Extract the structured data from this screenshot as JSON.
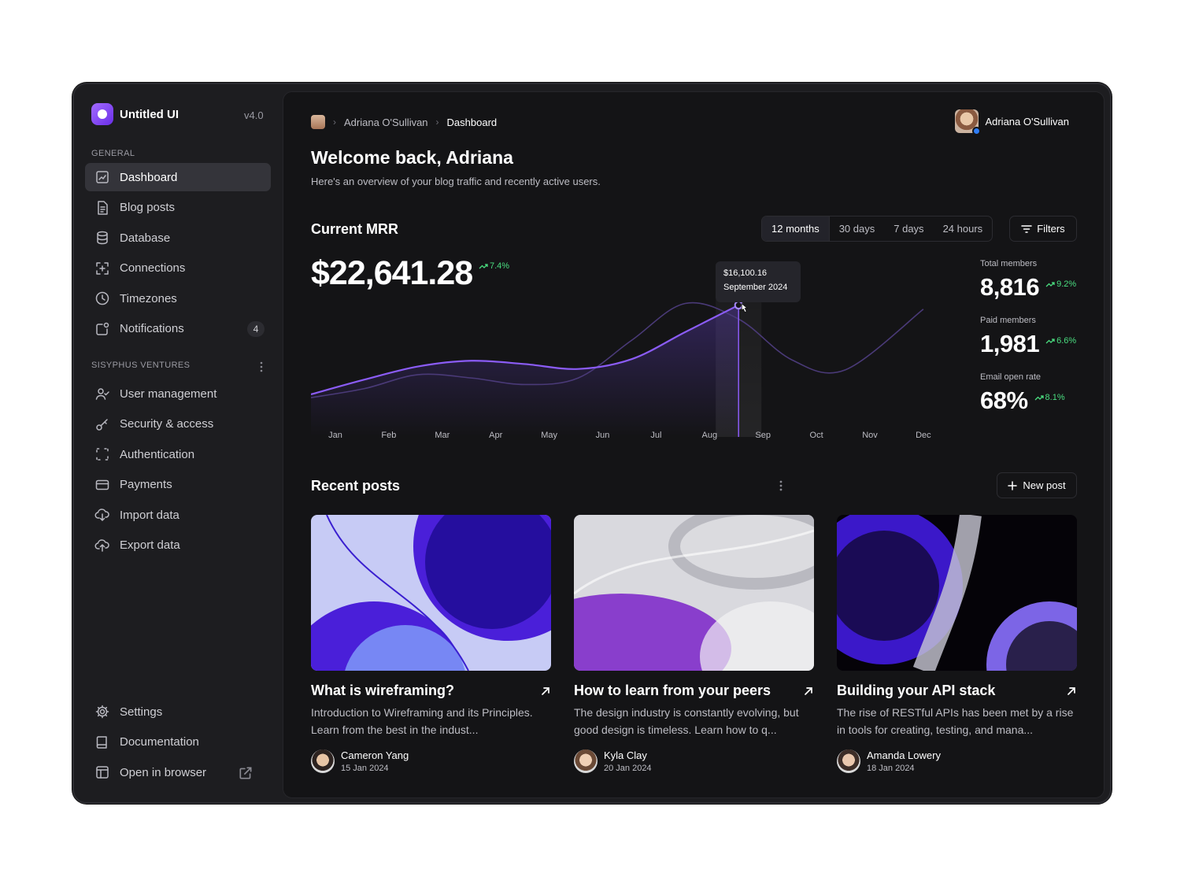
{
  "brand": {
    "name": "Untitled UI",
    "version": "v4.0"
  },
  "sidebar": {
    "general_label": "GENERAL",
    "general_items": [
      {
        "label": "Dashboard",
        "icon": "chart-icon",
        "active": true
      },
      {
        "label": "Blog posts",
        "icon": "document-icon"
      },
      {
        "label": "Database",
        "icon": "database-icon"
      },
      {
        "label": "Connections",
        "icon": "connections-icon"
      },
      {
        "label": "Timezones",
        "icon": "clock-icon"
      },
      {
        "label": "Notifications",
        "icon": "notification-icon",
        "badge": "4"
      }
    ],
    "workspace_label": "SISYPHUS VENTURES",
    "workspace_items": [
      {
        "label": "User management",
        "icon": "users-icon"
      },
      {
        "label": "Security & access",
        "icon": "key-icon"
      },
      {
        "label": "Authentication",
        "icon": "scan-icon"
      },
      {
        "label": "Payments",
        "icon": "credit-card-icon"
      },
      {
        "label": "Import data",
        "icon": "cloud-download-icon"
      },
      {
        "label": "Export data",
        "icon": "cloud-upload-icon"
      }
    ],
    "footer_items": [
      {
        "label": "Settings",
        "icon": "gear-icon"
      },
      {
        "label": "Documentation",
        "icon": "book-icon"
      },
      {
        "label": "Open in browser",
        "icon": "browser-icon"
      }
    ]
  },
  "breadcrumb": {
    "parent": "Adriana O'Sullivan",
    "current": "Dashboard"
  },
  "user": {
    "name": "Adriana O'Sullivan"
  },
  "header": {
    "title": "Welcome back, Adriana",
    "subtitle": "Here's an overview of your blog traffic and recently active users."
  },
  "mrr": {
    "title": "Current MRR",
    "value": "$22,641.28",
    "delta": "7.4%",
    "ranges": [
      "12 months",
      "30 days",
      "7 days",
      "24 hours"
    ],
    "active_range": "12 months",
    "filters_label": "Filters",
    "tooltip": {
      "value": "$16,100.16",
      "label": "September 2024"
    }
  },
  "chart_data": {
    "type": "line",
    "categories": [
      "Jan",
      "Feb",
      "Mar",
      "Apr",
      "May",
      "Jun",
      "Jul",
      "Aug",
      "Sep",
      "Oct",
      "Nov",
      "Dec"
    ],
    "series": [
      {
        "values": [
          5.2,
          7.0,
          8.6,
          9.3,
          8.9,
          8.3,
          9.5,
          12.8,
          16.1,
          null,
          null,
          null
        ]
      },
      {
        "values": [
          4.8,
          5.9,
          7.6,
          7.2,
          6.4,
          7.2,
          11.8,
          16.3,
          14.4,
          9.4,
          8.2,
          15.6
        ]
      }
    ],
    "highlight": {
      "category": "Sep",
      "value": 16100.16
    },
    "grid": false,
    "legend": "none"
  },
  "stats": [
    {
      "label": "Total members",
      "value": "8,816",
      "delta": "9.2%"
    },
    {
      "label": "Paid members",
      "value": "1,981",
      "delta": "6.6%"
    },
    {
      "label": "Email open rate",
      "value": "68%",
      "delta": "8.1%"
    }
  ],
  "recent": {
    "title": "Recent posts",
    "new_post_label": "New post",
    "posts": [
      {
        "title": "What is wireframing?",
        "desc": "Introduction to Wireframing and its Principles. Learn from the best in the indust...",
        "author": "Cameron Yang",
        "date": "15 Jan 2024",
        "palette": [
          "#c7cbf5",
          "#4a1fd9",
          "#1c0a8f",
          "#8ab4ff"
        ]
      },
      {
        "title": "How to learn from your peers",
        "desc": "The design industry is constantly evolving, but good design is timeless. Learn how to q...",
        "author": "Kyla Clay",
        "date": "20 Jan 2024",
        "palette": [
          "#d9d9de",
          "#7a22c9",
          "#b5b5bc",
          "#f2f2f4"
        ]
      },
      {
        "title": "Building your API stack",
        "desc": "The rise of RESTful APIs has been met by a rise in tools for creating, testing, and mana...",
        "author": "Amanda Lowery",
        "date": "18 Jan 2024",
        "palette": [
          "#050308",
          "#3b18c9",
          "#8a70ff",
          "#c8c8d4"
        ]
      }
    ]
  },
  "colors": {
    "accent": "#7c4dff",
    "positive": "#4ade80",
    "panel": "#141416",
    "sidebar": "#1d1d20"
  }
}
